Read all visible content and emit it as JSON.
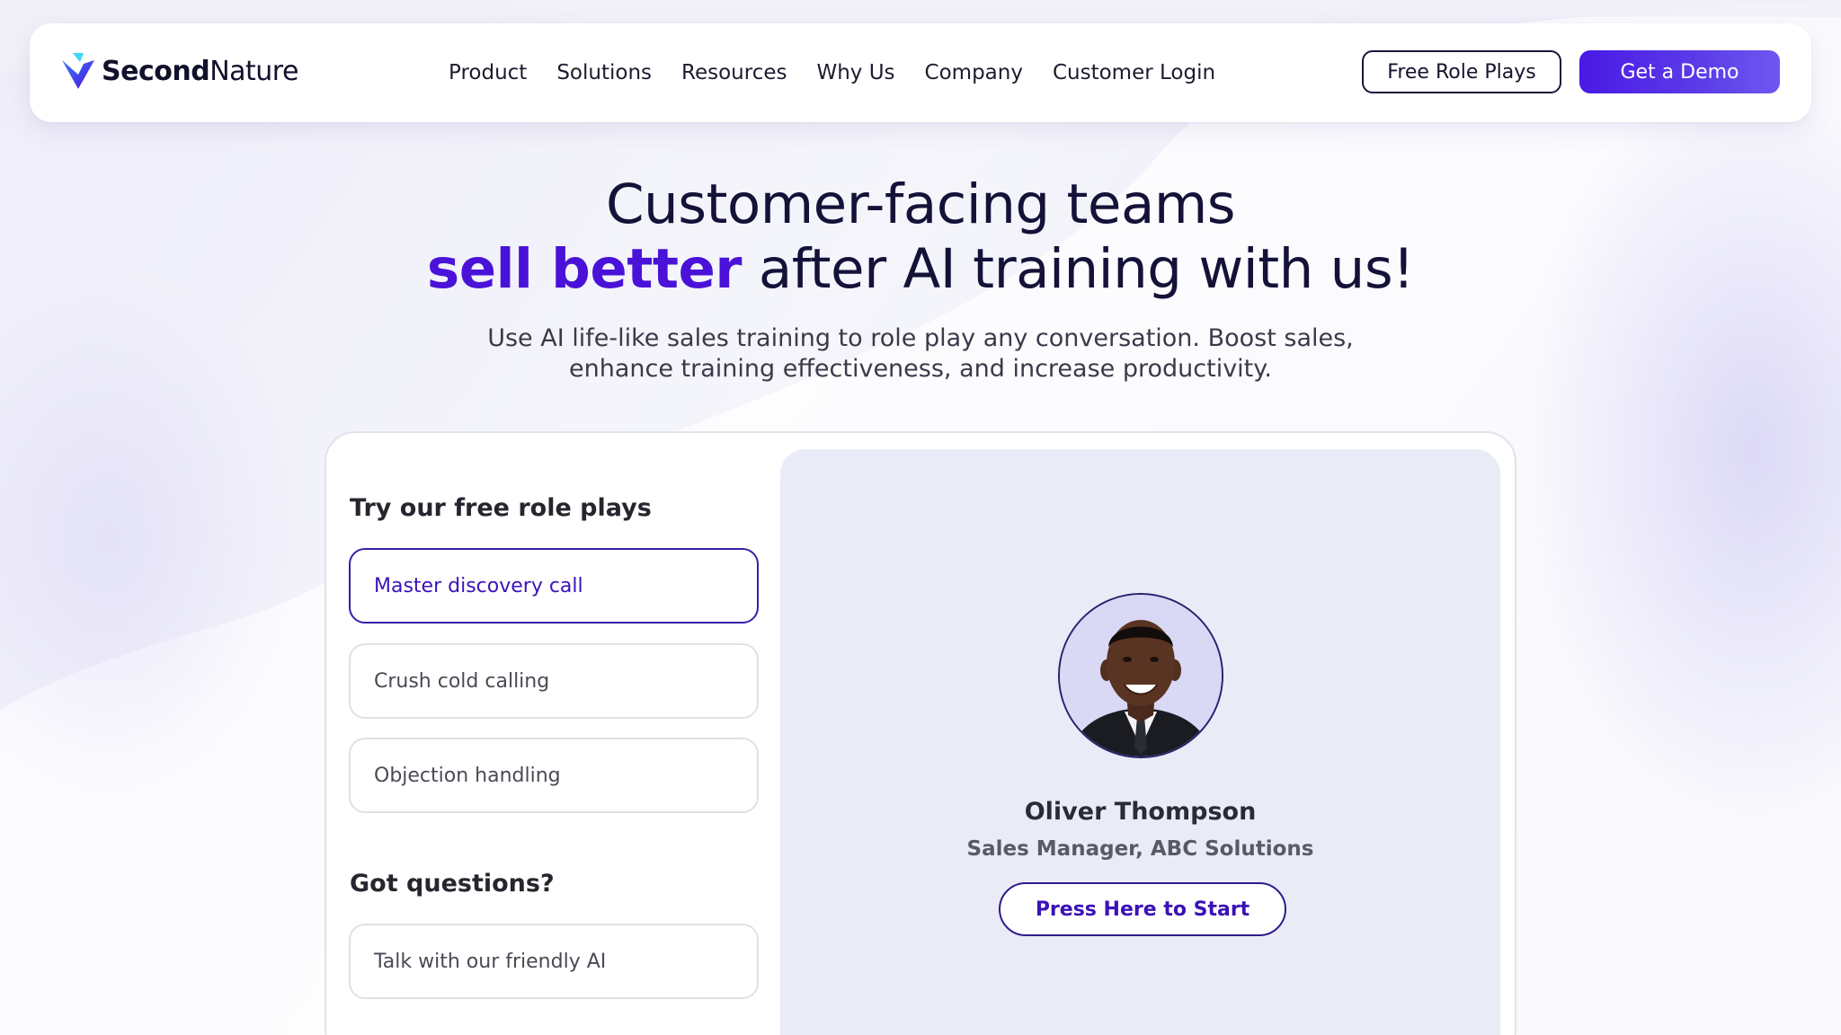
{
  "brand": {
    "logo_strong": "Second",
    "logo_light": "Nature",
    "accent_color": "#4a12d8"
  },
  "nav": {
    "items": [
      {
        "label": "Product"
      },
      {
        "label": "Solutions"
      },
      {
        "label": "Resources"
      },
      {
        "label": "Why Us"
      },
      {
        "label": "Company"
      },
      {
        "label": "Customer Login"
      }
    ],
    "free_role_plays": "Free Role Plays",
    "get_demo": "Get a Demo"
  },
  "hero": {
    "line1": "Customer-facing teams",
    "line2_accent": "sell better",
    "line2_rest": " after AI training with us!",
    "sub_line1": "Use AI life-like sales training to role play any conversation. Boost sales,",
    "sub_line2": "enhance training effectiveness, and increase productivity."
  },
  "roleplays": {
    "title": "Try our free role plays",
    "options": [
      {
        "label": "Master discovery call",
        "active": true
      },
      {
        "label": "Crush cold calling",
        "active": false
      },
      {
        "label": "Objection handling",
        "active": false
      }
    ]
  },
  "questions": {
    "title": "Got questions?",
    "option": "Talk with our friendly AI"
  },
  "persona": {
    "name": "Oliver Thompson",
    "role": "Sales Manager, ABC Solutions",
    "start_button": "Press Here to Start"
  },
  "icons": {
    "logo": "secondnature-logo-icon",
    "avatar": "persona-avatar-image"
  }
}
